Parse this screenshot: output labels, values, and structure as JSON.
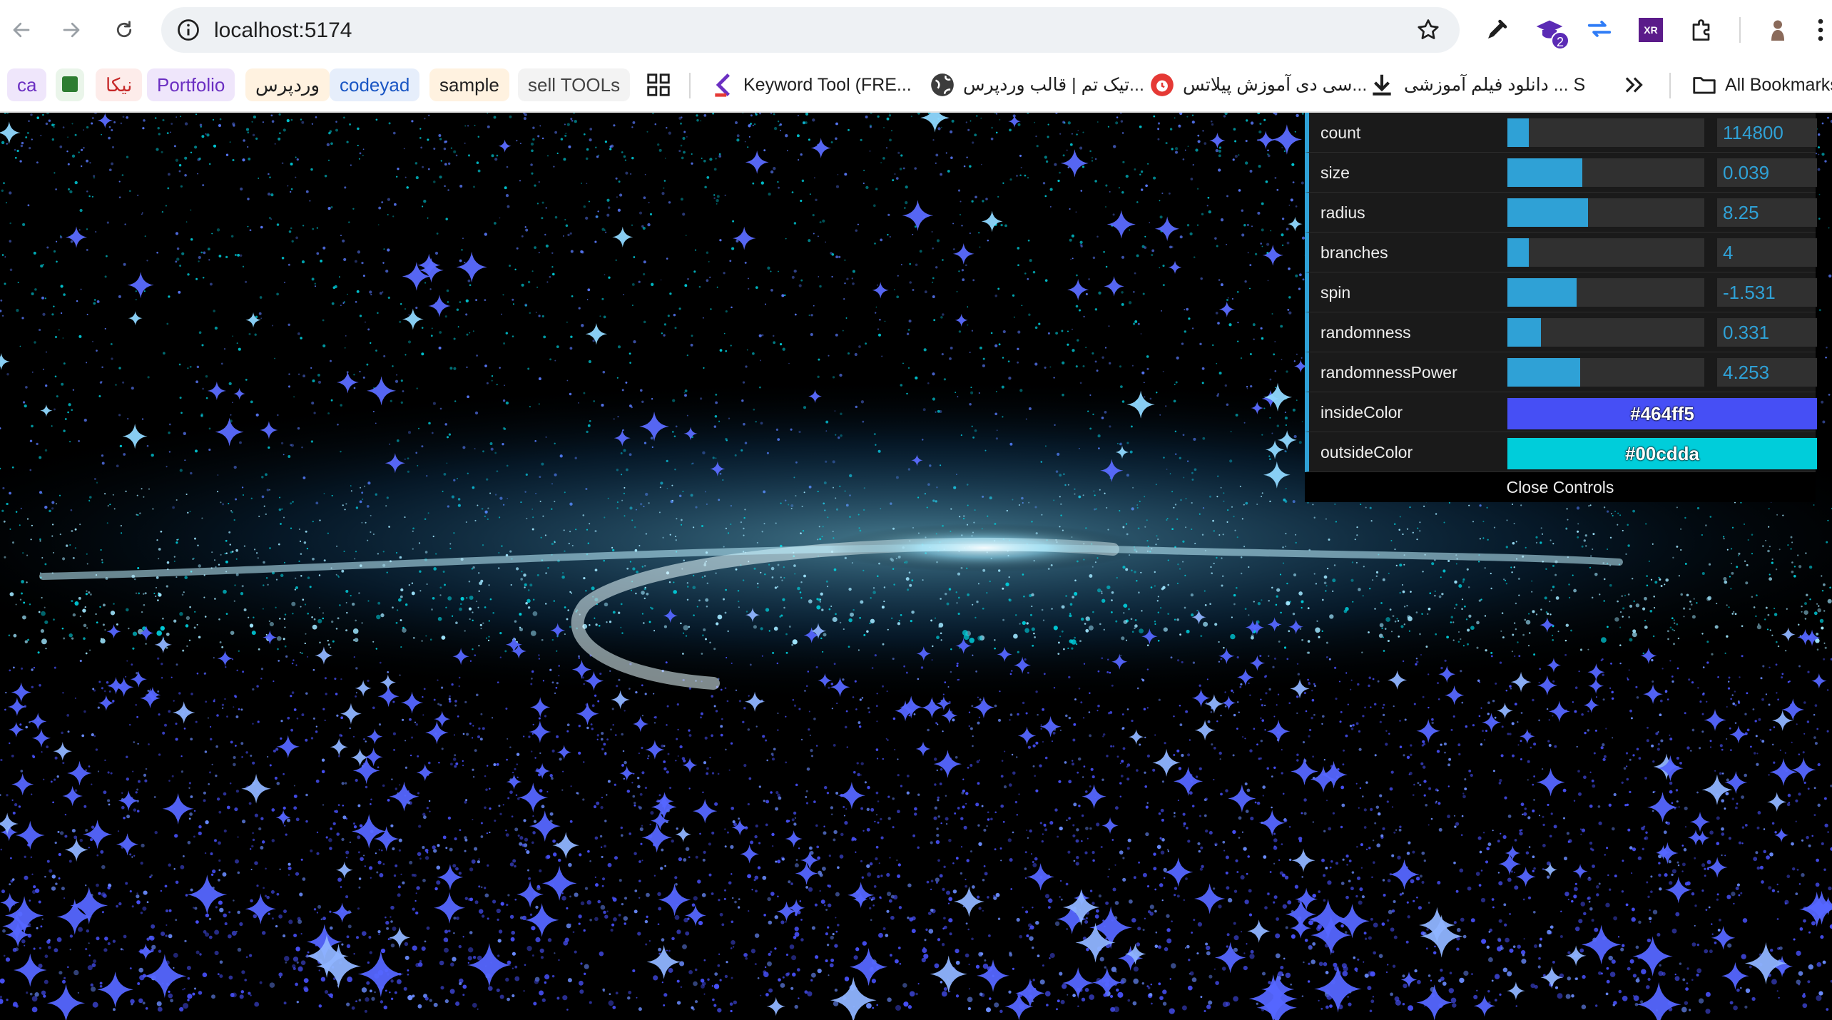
{
  "browser": {
    "url": "localhost:5174",
    "extension_badge": "2",
    "xr_label": "XR"
  },
  "bookmarks": {
    "items": [
      {
        "label": "ca",
        "bg": "#efe6fb",
        "color": "#6b2fc2"
      },
      {
        "label": "",
        "bg": "#eaf5ea",
        "color": "#2e7d32"
      },
      {
        "label": "نیکا",
        "bg": "#fdecea",
        "color": "#c62828"
      },
      {
        "label": "Portfolio",
        "bg": "#efe6fb",
        "color": "#6b2fc2"
      },
      {
        "label": "وردپرس",
        "bg": "#fff2e0",
        "color": "#1f1f1f"
      },
      {
        "label": "codeyad",
        "bg": "#e6eefb",
        "color": "#1a56c4"
      },
      {
        "label": "sample",
        "bg": "#fff2e0",
        "color": "#1f1f1f"
      },
      {
        "label": "sell TOOLs",
        "bg": "#f3f3f3",
        "color": "#444444"
      }
    ],
    "links": [
      {
        "label": "Keyword Tool (FRE..."
      },
      {
        "label": "تیک تم | قالب وردپرس..."
      },
      {
        "label": "سی دی آموزش پیلاتس..."
      },
      {
        "label": "دانلود فیلم آموزشی ... S"
      }
    ],
    "all_bookmarks": "All Bookmarks"
  },
  "gui": {
    "controls": [
      {
        "label": "count",
        "value": "114800",
        "fill": 0.11
      },
      {
        "label": "size",
        "value": "0.039",
        "fill": 0.38
      },
      {
        "label": "radius",
        "value": "8.25",
        "fill": 0.41
      },
      {
        "label": "branches",
        "value": "4",
        "fill": 0.11
      },
      {
        "label": "spin",
        "value": "-1.531",
        "fill": 0.35
      },
      {
        "label": "randomness",
        "value": "0.331",
        "fill": 0.17
      },
      {
        "label": "randomnessPower",
        "value": "4.253",
        "fill": 0.37
      }
    ],
    "colors": [
      {
        "label": "insideColor",
        "value": "#464ff5"
      },
      {
        "label": "outsideColor",
        "value": "#00cdda"
      }
    ],
    "close_label": "Close Controls"
  },
  "colors": {
    "accent": "#2fa1d6",
    "inside": "#464ff5",
    "outside": "#00cdda"
  }
}
